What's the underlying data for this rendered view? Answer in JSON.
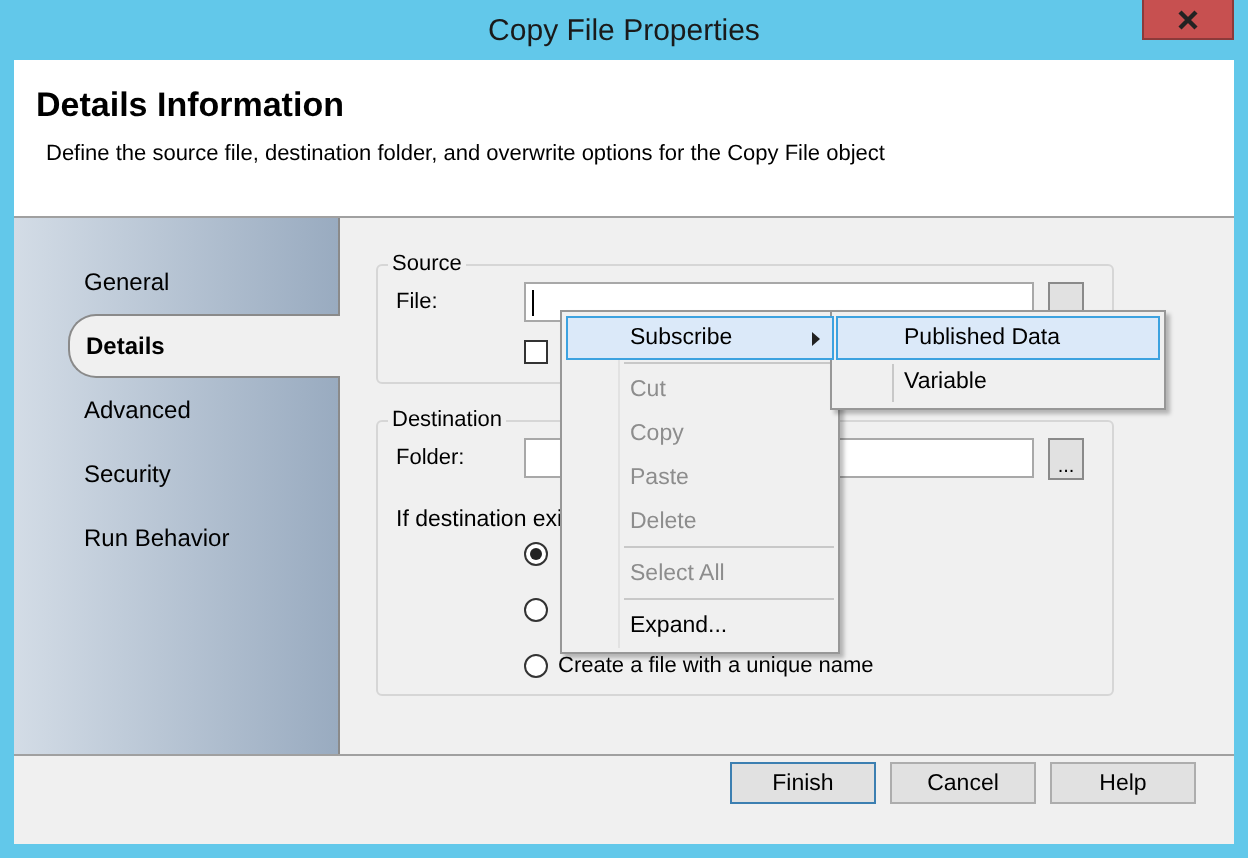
{
  "window": {
    "title": "Copy File Properties"
  },
  "header": {
    "title": "Details Information",
    "description": "Define the source file, destination folder, and overwrite options for the Copy File object"
  },
  "tabs": [
    {
      "label": "General",
      "selected": false
    },
    {
      "label": "Details",
      "selected": true
    },
    {
      "label": "Advanced",
      "selected": false
    },
    {
      "label": "Security",
      "selected": false
    },
    {
      "label": "Run Behavior",
      "selected": false
    }
  ],
  "source": {
    "title": "Source",
    "file_label": "File:",
    "checkbox": {
      "checked": false
    }
  },
  "destination": {
    "title": "Destination",
    "folder_label": "Folder:",
    "browse": "...",
    "condition_label": "If destination exi",
    "options": [
      {
        "selected": true
      },
      {
        "selected": false
      },
      {
        "selected": false,
        "label": "Create a file with a unique name"
      }
    ]
  },
  "context_menu": {
    "items": [
      {
        "kind": "item",
        "label": "Subscribe",
        "submenu": true,
        "selected": true,
        "disabled": false
      },
      {
        "kind": "separator"
      },
      {
        "kind": "item",
        "label": "Cut",
        "submenu": false,
        "selected": false,
        "disabled": true
      },
      {
        "kind": "item",
        "label": "Copy",
        "submenu": false,
        "selected": false,
        "disabled": true
      },
      {
        "kind": "item",
        "label": "Paste",
        "submenu": false,
        "selected": false,
        "disabled": true
      },
      {
        "kind": "item",
        "label": "Delete",
        "submenu": false,
        "selected": false,
        "disabled": true
      },
      {
        "kind": "separator"
      },
      {
        "kind": "item",
        "label": "Select All",
        "submenu": false,
        "selected": false,
        "disabled": true
      },
      {
        "kind": "separator"
      },
      {
        "kind": "item",
        "label": "Expand...",
        "submenu": false,
        "selected": false,
        "disabled": false
      }
    ]
  },
  "submenu": {
    "items": [
      {
        "label": "Published Data",
        "selected": true
      },
      {
        "label": "Variable",
        "selected": false
      }
    ]
  },
  "buttons": [
    {
      "label": "Finish",
      "default": true
    },
    {
      "label": "Cancel",
      "default": false
    },
    {
      "label": "Help",
      "default": false
    }
  ]
}
